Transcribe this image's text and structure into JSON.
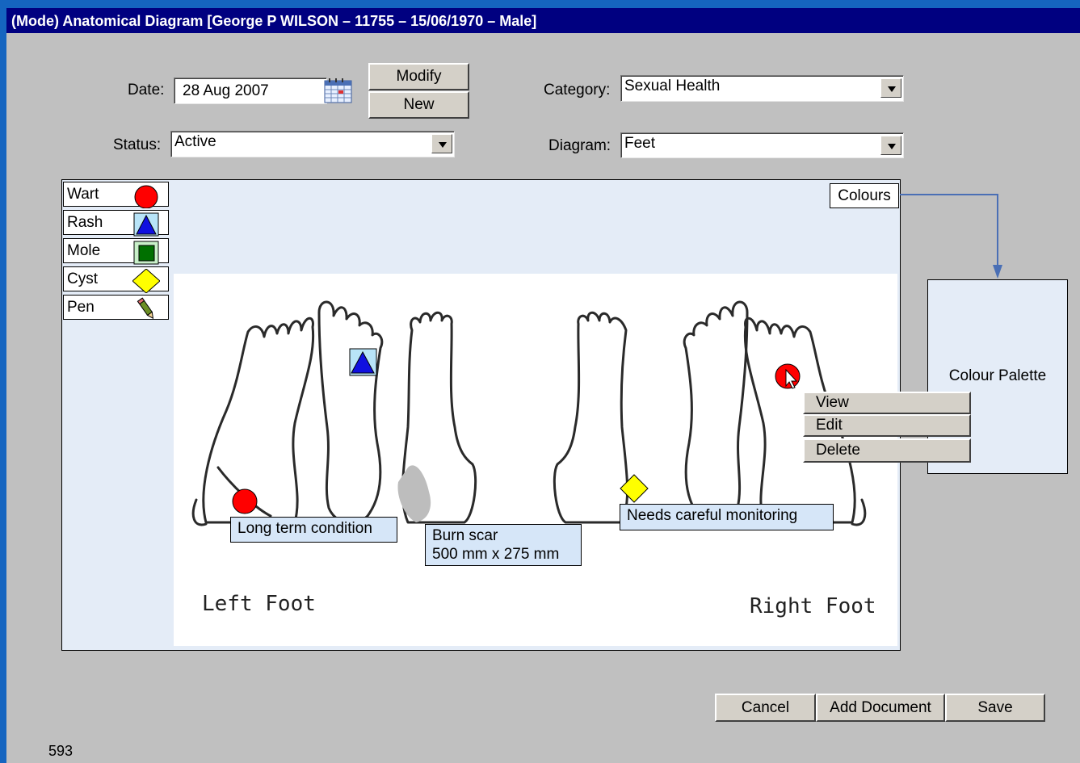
{
  "window": {
    "title": "(Mode) Anatomical Diagram [George P WILSON – 11755 – 15/06/1970 – Male]"
  },
  "form": {
    "date_label": "Date:",
    "date_value": "28 Aug 2007",
    "status_label": "Status:",
    "status_value": "Active",
    "category_label": "Category:",
    "category_value": "Sexual Health",
    "diagram_label": "Diagram:",
    "diagram_value": "Feet",
    "modify_label": "Modify",
    "new_label": "New"
  },
  "tools": [
    {
      "label": "Wart",
      "icon": "red-circle-icon",
      "color": "#ff0000"
    },
    {
      "label": "Rash",
      "icon": "blue-triangle-icon",
      "color": "#0000ff"
    },
    {
      "label": "Mole",
      "icon": "green-square-icon",
      "color": "#008000"
    },
    {
      "label": "Cyst",
      "icon": "yellow-diamond-icon",
      "color": "#ffff00"
    },
    {
      "label": "Pen",
      "icon": "pen-icon"
    }
  ],
  "diagram": {
    "colours_label": "Colours",
    "left_foot_label": "Left Foot",
    "right_foot_label": "Right Foot",
    "notes": {
      "long_term": "Long term condition",
      "burn_scar_line1": "Burn scar",
      "burn_scar_line2": "500 mm x 275 mm",
      "monitoring": "Needs careful monitoring"
    }
  },
  "palette": {
    "label": "Colour Palette"
  },
  "context_menu": {
    "view": "View",
    "edit": "Edit",
    "delete": "Delete"
  },
  "footer": {
    "cancel": "Cancel",
    "add_document": "Add Document",
    "save": "Save",
    "number": "593"
  }
}
